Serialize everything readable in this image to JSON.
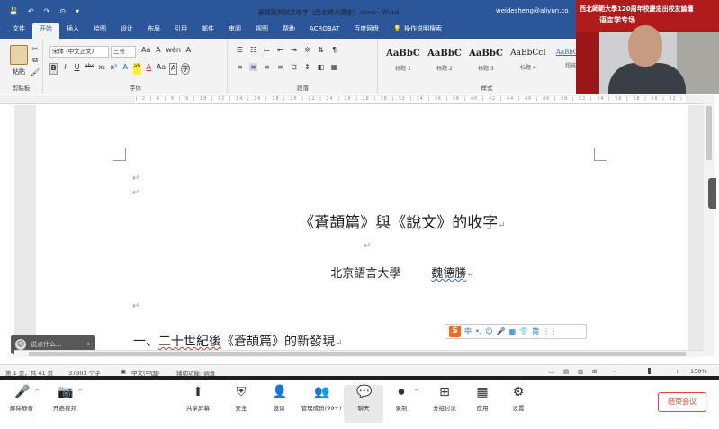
{
  "titlebar": {
    "qat": [
      "💾",
      "↶",
      "↷",
      "⊙",
      "▾"
    ],
    "title": "蒼頡篇與說文收字（西北師大講座）.docx - Word",
    "user": "weidesheng@aliyun.co"
  },
  "ribbon_tabs": [
    "文件",
    "开始",
    "插入",
    "绘图",
    "设计",
    "布局",
    "引用",
    "邮件",
    "审阅",
    "视图",
    "帮助",
    "ACROBAT",
    "百度网盘",
    "操作说明搜索"
  ],
  "ribbon": {
    "clipboard": {
      "paste_label": "粘贴",
      "group_label": "剪贴板"
    },
    "font": {
      "font_name": "宋体 (中文正文)",
      "font_size": "三号",
      "row1_extra": [
        "Aa",
        "A",
        "wén",
        "A"
      ],
      "row2": [
        "B",
        "I",
        "U",
        "abc",
        "x₂",
        "x²",
        "A",
        "ab",
        "A",
        "Aa",
        "A",
        "字"
      ],
      "group_label": "字体"
    },
    "paragraph": {
      "group_label": "段落"
    },
    "styles": {
      "cards": [
        {
          "sample": "AaBbC",
          "name": "标题 1"
        },
        {
          "sample": "AaBbC",
          "name": "标题 2"
        },
        {
          "sample": "AaBbC",
          "name": "标题 3"
        },
        {
          "sample": "AaBbCcI",
          "name": "标题 4"
        },
        {
          "sample": "AaBbCcDd",
          "name": "超链接"
        }
      ],
      "group_label": "样式"
    }
  },
  "document": {
    "title": "《蒼頡篇》與《說文》的收字",
    "affiliation": "北京語言大學",
    "author": "魏德勝",
    "section_prefix": "一、",
    "section_underlined": "二十世紀後",
    "section_rest": "《蒼頡篇》的新發現",
    "para_mark": "↵"
  },
  "ime_bar": {
    "logo": "S",
    "items": [
      "中",
      "•,",
      "☺",
      "🎤",
      "▦",
      "👕",
      "简",
      "⋮⋮"
    ]
  },
  "chat": {
    "placeholder": "说点什么...",
    "chevron": "‹"
  },
  "statusbar": {
    "page": "第 1 页，共 41 页",
    "words": "37303 个字",
    "lang": "中文(中国)",
    "accessibility": "辅助功能: 调查",
    "zoom": "150%"
  },
  "meeting": {
    "buttons": [
      {
        "icon": "🎤",
        "label": "解除静音"
      },
      {
        "icon": "📷",
        "label": "开启视频"
      },
      {
        "icon": "⬆",
        "label": "共享屏幕"
      },
      {
        "icon": "⛨",
        "label": "安全"
      },
      {
        "icon": "👤",
        "label": "邀请"
      },
      {
        "icon": "👥",
        "label": "管理成员(99+)"
      },
      {
        "icon": "💬",
        "label": "聊天"
      },
      {
        "icon": "⏺",
        "label": "录制"
      },
      {
        "icon": "⊞",
        "label": "分组讨论"
      },
      {
        "icon": "▦",
        "label": "应用"
      },
      {
        "icon": "⚙",
        "label": "设置"
      }
    ],
    "end": "结束会议"
  },
  "video": {
    "banner_line1": "西北師範大學120周年校慶忠出校友論壇",
    "banner_line2": "语言学专场"
  },
  "colors": {
    "word_blue": "#2b579a",
    "end_red": "#e0443e",
    "banner_red": "#b01b1b"
  }
}
